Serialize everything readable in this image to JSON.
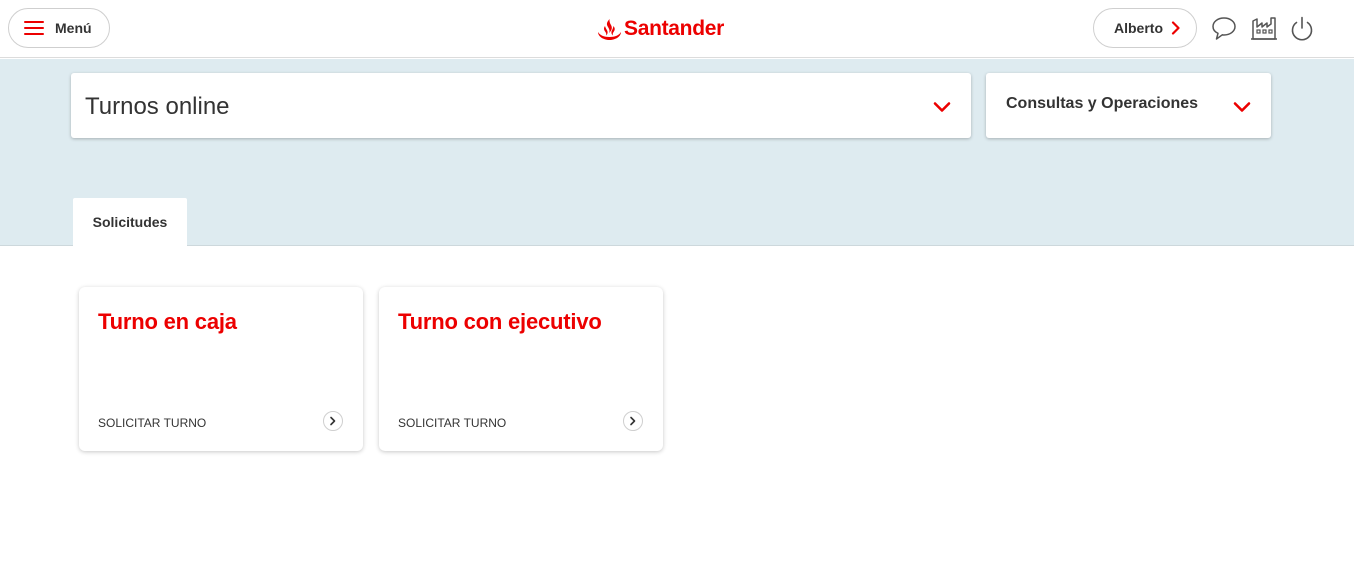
{
  "header": {
    "menu_label": "Menú",
    "brand_name": "Santander",
    "user_label": "Alberto",
    "icons": [
      "chat-icon",
      "branch-icon",
      "power-icon"
    ]
  },
  "selectors": {
    "main": "Turnos online",
    "operations": "Consultas y Operaciones"
  },
  "tabs": [
    {
      "label": "Solicitudes",
      "active": true
    }
  ],
  "cards": [
    {
      "title": "Turno en caja",
      "action": "SOLICITAR TURNO"
    },
    {
      "title": "Turno con ejecutivo",
      "action": "SOLICITAR TURNO"
    }
  ],
  "colors": {
    "brand_red": "#ec0000",
    "band_blue": "#deebf0",
    "text": "#333333"
  }
}
